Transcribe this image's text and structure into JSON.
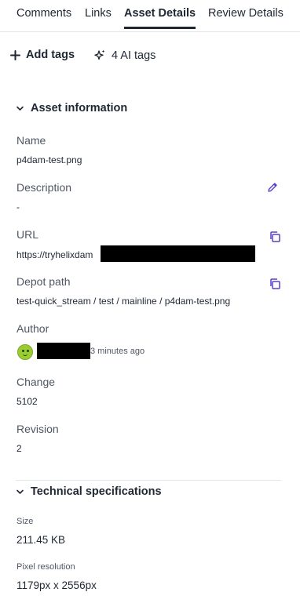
{
  "tabs": [
    {
      "label": "Comments"
    },
    {
      "label": "Links"
    },
    {
      "label": "Asset Details"
    },
    {
      "label": "Review Details"
    }
  ],
  "tag_bar": {
    "add_tags_label": "Add tags",
    "ai_tags_label": "4 AI tags"
  },
  "asset_info": {
    "title": "Asset information",
    "name_label": "Name",
    "name_value": "p4dam-test.png",
    "description_label": "Description",
    "description_value": "-",
    "url_label": "URL",
    "url_value": "https://tryhelixdam",
    "depot_label": "Depot path",
    "depot_value": "test-quick_stream / test / mainline / p4dam-test.png",
    "author_label": "Author",
    "author_time": "3 minutes ago",
    "change_label": "Change",
    "change_value": "5102",
    "revision_label": "Revision",
    "revision_value": "2"
  },
  "tech_specs": {
    "title": "Technical specifications",
    "size_label": "Size",
    "size_value": "211.45 KB",
    "resolution_label": "Pixel resolution",
    "resolution_value": "1179px x 2556px"
  },
  "colors": {
    "accent": "#5b3fc8",
    "text": "#1f2733",
    "muted": "#4f5663",
    "avatar": "#9acd32"
  }
}
